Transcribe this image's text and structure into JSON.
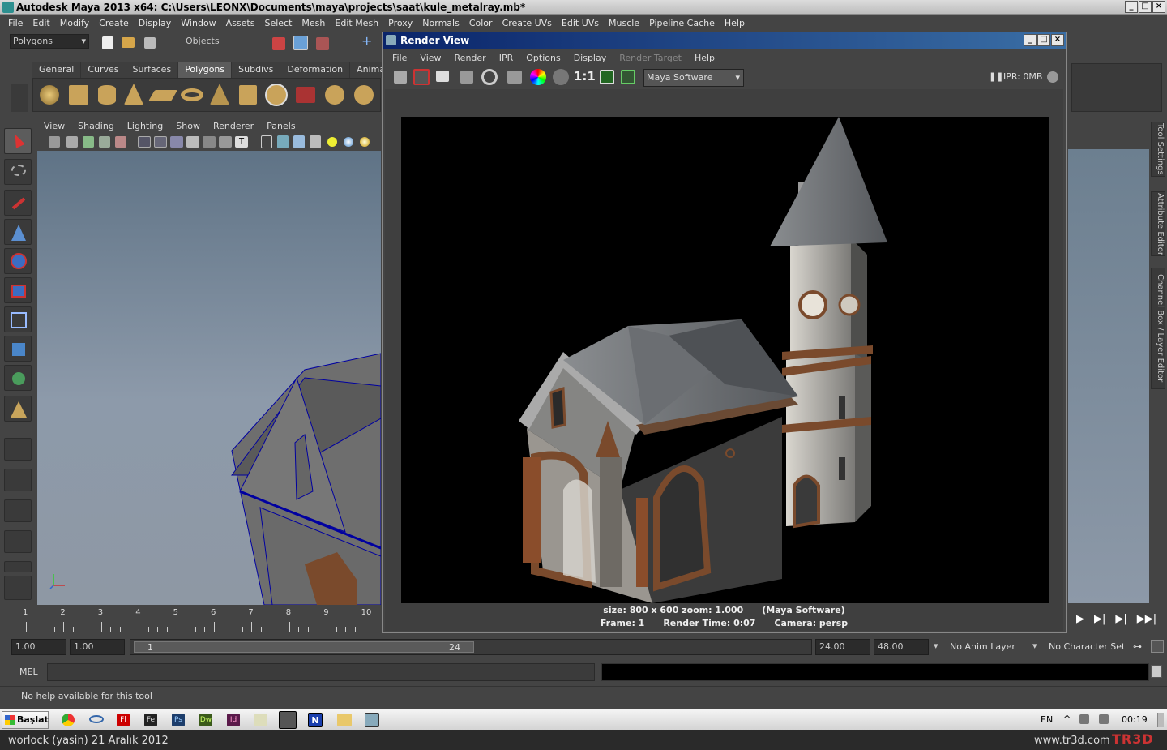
{
  "window": {
    "title": "Autodesk Maya 2013 x64: C:\\Users\\LEONX\\Documents\\maya\\projects\\saat\\kule_metalray.mb*"
  },
  "menu": [
    "File",
    "Edit",
    "Modify",
    "Create",
    "Display",
    "Window",
    "Assets",
    "Select",
    "Mesh",
    "Edit Mesh",
    "Proxy",
    "Normals",
    "Color",
    "Create UVs",
    "Edit UVs",
    "Muscle",
    "Pipeline Cache",
    "Help"
  ],
  "statusline": {
    "mode": "Polygons",
    "selection_mode": "Objects"
  },
  "shelf": {
    "tabs": [
      "General",
      "Curves",
      "Surfaces",
      "Polygons",
      "Subdivs",
      "Deformation",
      "Anima"
    ],
    "active": "Polygons"
  },
  "viewport": {
    "menu": [
      "View",
      "Shading",
      "Lighting",
      "Show",
      "Renderer",
      "Panels"
    ]
  },
  "render_view": {
    "title": "Render View",
    "menu": [
      "File",
      "View",
      "Render",
      "IPR",
      "Options",
      "Display",
      "Render Target",
      "Help"
    ],
    "ratio_label": "1:1",
    "renderer": "Maya Software",
    "ipr_label": "IPR: 0MB",
    "info_line1": "size: 800 x 600 zoom: 1.000",
    "info_line1b": "(Maya Software)",
    "info_frame": "Frame: 1",
    "info_time": "Render Time: 0:07",
    "info_camera": "Camera: persp"
  },
  "right_tabs": [
    "Tool Settings",
    "Attribute Editor",
    "Channel Box / Layer Editor"
  ],
  "timeline": {
    "ticks": [
      "1",
      "2",
      "3",
      "4",
      "5",
      "6",
      "7",
      "8",
      "9",
      "10"
    ]
  },
  "range": {
    "start": "1.00",
    "current": "1.00",
    "slider_start": "1",
    "slider_end": "24",
    "end": "24.00",
    "end_max": "48.00",
    "anim_layer": "No Anim Layer",
    "char_set": "No Character Set"
  },
  "cmd": {
    "label": "MEL"
  },
  "help": {
    "text": "No help available for this tool"
  },
  "taskbar": {
    "start": "Başlat",
    "lang": "EN",
    "clock": "00:19"
  },
  "footer": {
    "left": "worlock (yasin)   21 Aralık 2012",
    "right": "www.tr3d.com",
    "logo": "TR3D"
  },
  "colors": {
    "accent": "#0a246a",
    "maya_bg": "#444444"
  }
}
